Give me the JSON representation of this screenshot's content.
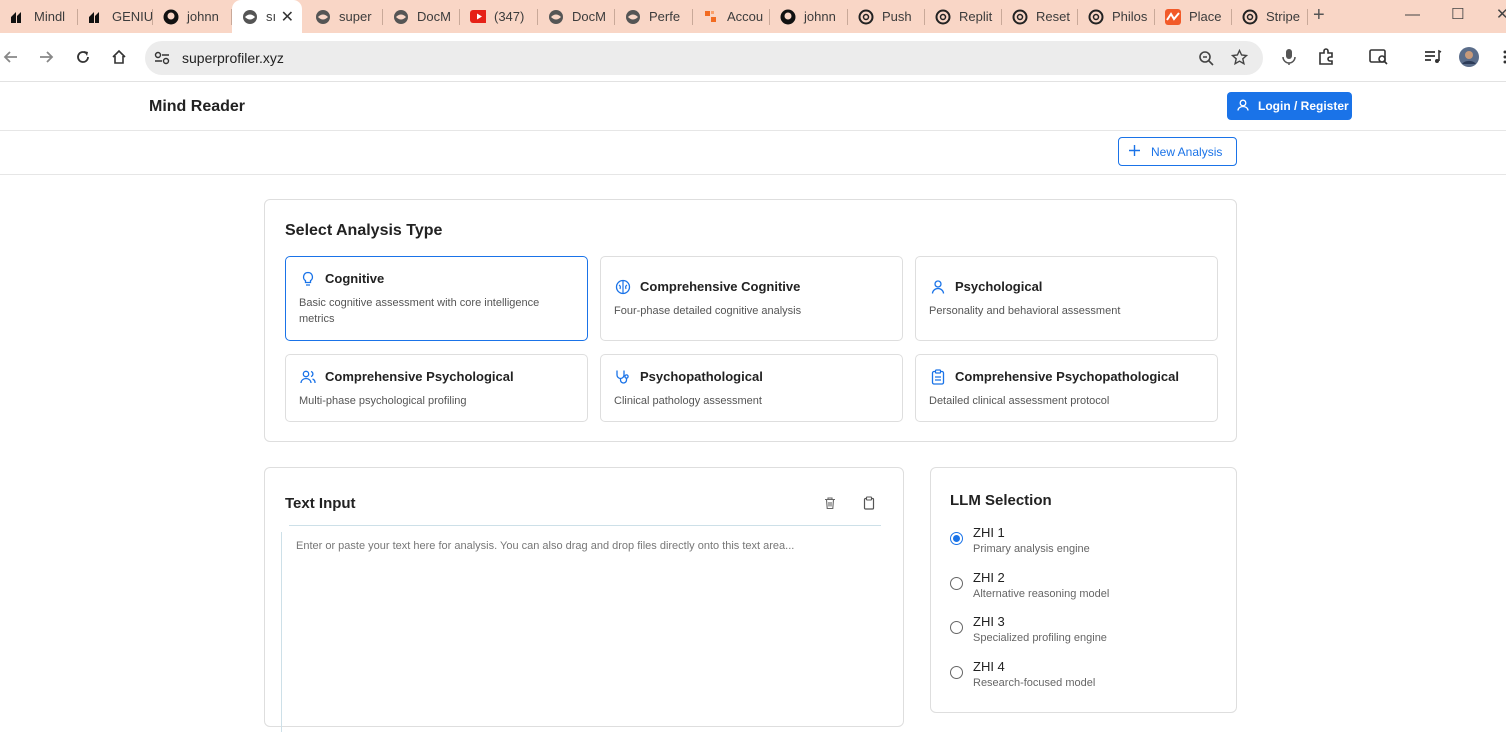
{
  "browser": {
    "tabs": [
      {
        "title": "Mindl",
        "icon": "black-logo-icon"
      },
      {
        "title": "GENIU",
        "icon": "black-logo-icon"
      },
      {
        "title": "johnn",
        "icon": "github-icon"
      },
      {
        "title": "sı",
        "icon": "globe-icon",
        "active": true
      },
      {
        "title": "super",
        "icon": "globe-icon"
      },
      {
        "title": "DocM",
        "icon": "globe-icon"
      },
      {
        "title": "(347)",
        "icon": "youtube-icon"
      },
      {
        "title": "DocM",
        "icon": "globe-icon"
      },
      {
        "title": "Perfe",
        "icon": "globe-icon"
      },
      {
        "title": "Accou",
        "icon": "orange-logo-icon"
      },
      {
        "title": "johnn",
        "icon": "github-icon"
      },
      {
        "title": "Push",
        "icon": "openai-icon"
      },
      {
        "title": "Replit",
        "icon": "openai-icon"
      },
      {
        "title": "Reset",
        "icon": "openai-icon"
      },
      {
        "title": "Philos",
        "icon": "openai-icon"
      },
      {
        "title": "Place",
        "icon": "orange-wave-icon"
      },
      {
        "title": "Stripe",
        "icon": "openai-icon"
      }
    ],
    "url": "superprofiler.xyz"
  },
  "header": {
    "brand": "Mind Reader",
    "login_label": "Login / Register"
  },
  "subbar": {
    "new_analysis_label": "New Analysis"
  },
  "analysis": {
    "title": "Select Analysis Type",
    "types": [
      {
        "name": "Cognitive",
        "desc": "Basic cognitive assessment with core intelligence metrics",
        "icon": "lightbulb-icon",
        "selected": true
      },
      {
        "name": "Comprehensive Cognitive",
        "desc": "Four-phase detailed cognitive analysis",
        "icon": "brain-icon"
      },
      {
        "name": "Psychological",
        "desc": "Personality and behavioral assessment",
        "icon": "user-icon"
      },
      {
        "name": "Comprehensive Psychological",
        "desc": "Multi-phase psychological profiling",
        "icon": "users-icon"
      },
      {
        "name": "Psychopathological",
        "desc": "Clinical pathology assessment",
        "icon": "stethoscope-icon"
      },
      {
        "name": "Comprehensive Psychopathological",
        "desc": "Detailed clinical assessment protocol",
        "icon": "clipboard-icon"
      }
    ]
  },
  "text_input": {
    "title": "Text Input",
    "placeholder": "Enter or paste your text here for analysis. You can also drag and drop files directly onto this text area..."
  },
  "llm": {
    "title": "LLM Selection",
    "options": [
      {
        "name": "ZHI 1",
        "desc": "Primary analysis engine",
        "selected": true
      },
      {
        "name": "ZHI 2",
        "desc": "Alternative reasoning model"
      },
      {
        "name": "ZHI 3",
        "desc": "Specialized profiling engine"
      },
      {
        "name": "ZHI 4",
        "desc": "Research-focused model"
      }
    ]
  },
  "colors": {
    "accent": "#1a73e8",
    "tabstrip": "#f9d6c6"
  }
}
